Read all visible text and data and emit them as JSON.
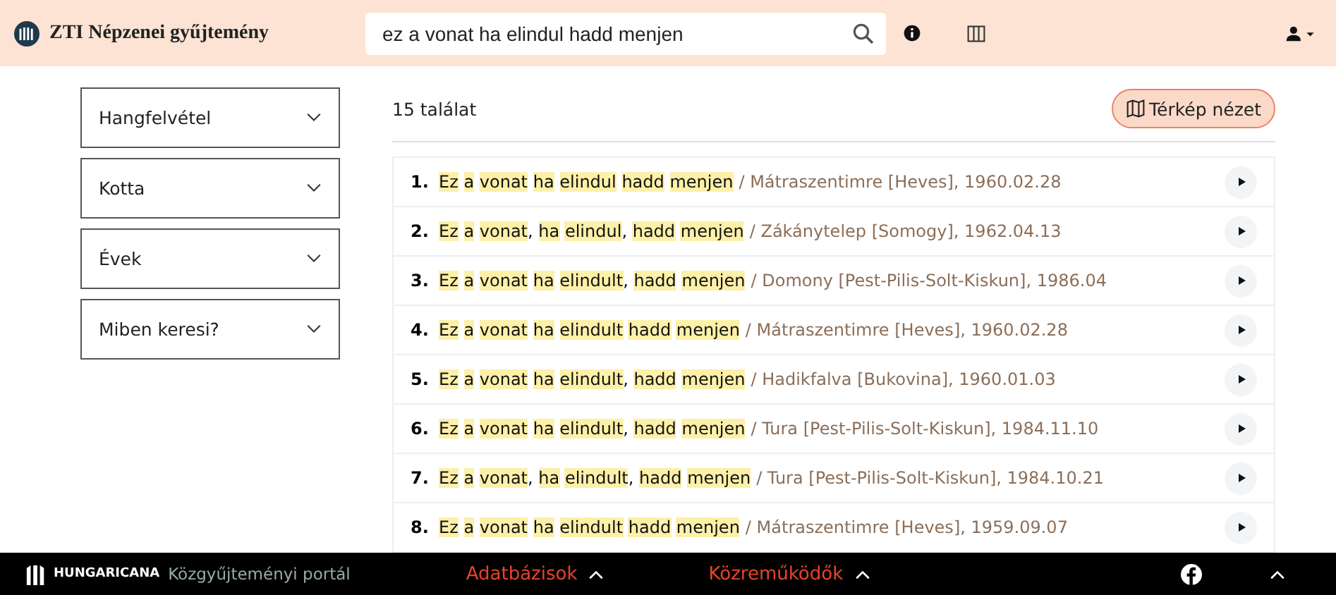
{
  "header": {
    "title": "ZTI Népzenei gyűjtemény",
    "search": {
      "value": "ez a vonat ha elindul hadd menjen"
    }
  },
  "filters": [
    {
      "label": "Hangfelvétel",
      "expanded": false
    },
    {
      "label": "Kotta",
      "expanded": false
    },
    {
      "label": "Évek",
      "expanded": false
    },
    {
      "label": "Miben keresi?",
      "expanded": false
    }
  ],
  "result_count": "15 találat",
  "map_button": "Térkép nézet",
  "results": [
    {
      "number": "1.",
      "words": [
        {
          "text": "Ez",
          "highlighted": true
        },
        {
          "text": "a",
          "highlighted": true
        },
        {
          "text": "vonat",
          "highlighted": true
        },
        {
          "text": "ha",
          "highlighted": true
        },
        {
          "text": "elindul",
          "highlighted": true
        },
        {
          "text": "hadd",
          "highlighted": true
        },
        {
          "text": "menjen",
          "highlighted": true
        }
      ],
      "meta": "/ Mátraszentimre [Heves], 1960.02.28"
    },
    {
      "number": "2.",
      "words": [
        {
          "text": "Ez",
          "highlighted": true
        },
        {
          "text": "a",
          "highlighted": true
        },
        {
          "text": "vonat",
          "highlighted": true,
          "punctuation": ","
        },
        {
          "text": "ha",
          "highlighted": true
        },
        {
          "text": "elindul",
          "highlighted": true,
          "punctuation": ","
        },
        {
          "text": "hadd",
          "highlighted": true
        },
        {
          "text": "menjen",
          "highlighted": true
        }
      ],
      "meta": "/ Zákánytelep [Somogy], 1962.04.13"
    },
    {
      "number": "3.",
      "words": [
        {
          "text": "Ez",
          "highlighted": true
        },
        {
          "text": "a",
          "highlighted": true
        },
        {
          "text": "vonat",
          "highlighted": true
        },
        {
          "text": "ha",
          "highlighted": true
        },
        {
          "text": "elindult",
          "highlighted": true,
          "punctuation": ","
        },
        {
          "text": "hadd",
          "highlighted": true
        },
        {
          "text": "menjen",
          "highlighted": true
        }
      ],
      "meta": "/ Domony [Pest-Pilis-Solt-Kiskun], 1986.04"
    },
    {
      "number": "4.",
      "words": [
        {
          "text": "Ez",
          "highlighted": true
        },
        {
          "text": "a",
          "highlighted": true
        },
        {
          "text": "vonat",
          "highlighted": true
        },
        {
          "text": "ha",
          "highlighted": true
        },
        {
          "text": "elindult",
          "highlighted": true
        },
        {
          "text": "hadd",
          "highlighted": true
        },
        {
          "text": "menjen",
          "highlighted": true
        }
      ],
      "meta": "/ Mátraszentimre [Heves], 1960.02.28"
    },
    {
      "number": "5.",
      "words": [
        {
          "text": "Ez",
          "highlighted": true
        },
        {
          "text": "a",
          "highlighted": true
        },
        {
          "text": "vonat",
          "highlighted": true
        },
        {
          "text": "ha",
          "highlighted": true
        },
        {
          "text": "elindult",
          "highlighted": true,
          "punctuation": ","
        },
        {
          "text": "hadd",
          "highlighted": true
        },
        {
          "text": "menjen",
          "highlighted": true
        }
      ],
      "meta": "/ Hadikfalva [Bukovina], 1960.01.03"
    },
    {
      "number": "6.",
      "words": [
        {
          "text": "Ez",
          "highlighted": true
        },
        {
          "text": "a",
          "highlighted": true
        },
        {
          "text": "vonat",
          "highlighted": true
        },
        {
          "text": "ha",
          "highlighted": true
        },
        {
          "text": "elindult",
          "highlighted": true,
          "punctuation": ","
        },
        {
          "text": "hadd",
          "highlighted": true
        },
        {
          "text": "menjen",
          "highlighted": true
        }
      ],
      "meta": "/ Tura [Pest-Pilis-Solt-Kiskun], 1984.11.10"
    },
    {
      "number": "7.",
      "words": [
        {
          "text": "Ez",
          "highlighted": true
        },
        {
          "text": "a",
          "highlighted": true
        },
        {
          "text": "vonat",
          "highlighted": true,
          "punctuation": ","
        },
        {
          "text": "ha",
          "highlighted": true
        },
        {
          "text": "elindult",
          "highlighted": true,
          "punctuation": ","
        },
        {
          "text": "hadd",
          "highlighted": true
        },
        {
          "text": "menjen",
          "highlighted": true
        }
      ],
      "meta": "/ Tura [Pest-Pilis-Solt-Kiskun], 1984.10.21"
    },
    {
      "number": "8.",
      "words": [
        {
          "text": "Ez",
          "highlighted": true
        },
        {
          "text": "a",
          "highlighted": true
        },
        {
          "text": "vonat",
          "highlighted": true
        },
        {
          "text": "ha",
          "highlighted": true
        },
        {
          "text": "elindult",
          "highlighted": true
        },
        {
          "text": "hadd",
          "highlighted": true
        },
        {
          "text": "menjen",
          "highlighted": true
        }
      ],
      "meta": "/ Mátraszentimre [Heves], 1959.09.07"
    }
  ],
  "footer": {
    "brand": "HUNGARICANA",
    "portal": "Közgyűjteményi portál",
    "links": [
      "Adatbázisok",
      "Közreműködők"
    ]
  }
}
